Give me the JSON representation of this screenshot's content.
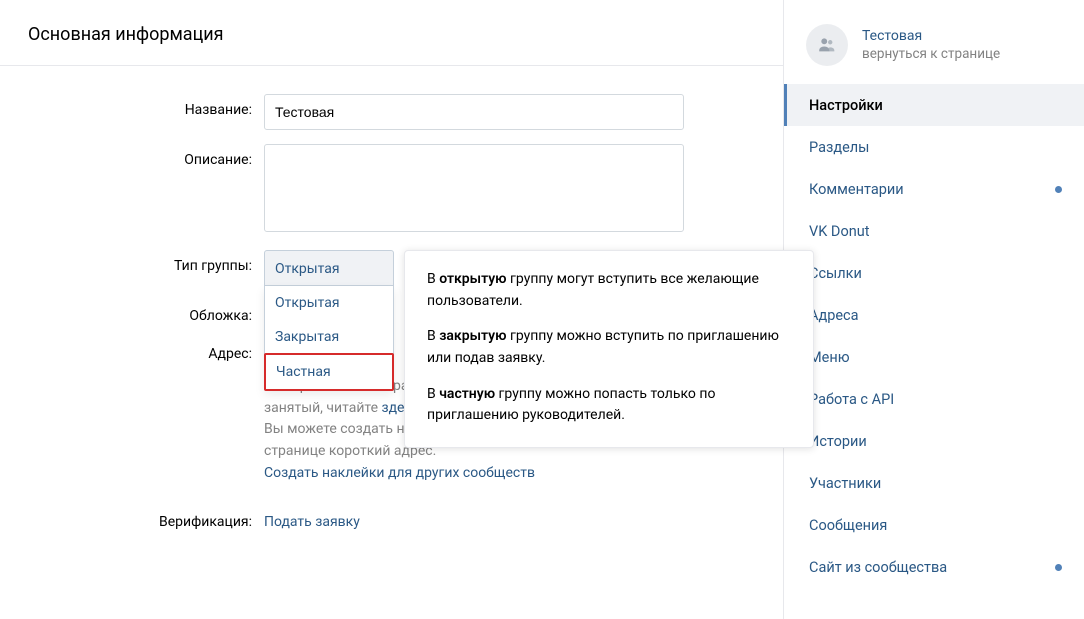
{
  "page_title": "Основная информация",
  "form": {
    "name_label": "Название:",
    "name_value": "Тестовая",
    "description_label": "Описание:",
    "description_value": "",
    "group_type_label": "Тип группы:",
    "group_type_selected": "Открытая",
    "group_type_options": [
      "Открытая",
      "Закрытая",
      "Частная"
    ],
    "cover_label": "Обложка:",
    "address_label": "Адрес:",
    "address_hint_1": "Как правильно выбрать адрес и можно ли использовать уже занятый, читайте ",
    "address_hint_link": "здесь",
    "address_hint_1_end": ".",
    "address_hint_2": "Вы можете создать наклейки для вашего сообщества, добавив странице короткий адрес.",
    "address_stickers_link": "Создать наклейки для других сообществ",
    "verification_label": "Верификация:",
    "verification_link": "Подать заявку"
  },
  "tooltip": {
    "open_pre": "В ",
    "open_bold": "открытую",
    "open_post": " группу могут вступить все желающие пользователи.",
    "closed_pre": "В ",
    "closed_bold": "закрытую",
    "closed_post": " группу можно вступить по приглашению или подав заявку.",
    "private_pre": "В ",
    "private_bold": "частную",
    "private_post": " группу можно попасть только по приглашению руководителей."
  },
  "sidebar": {
    "group_name": "Тестовая",
    "group_back": "вернуться к странице",
    "nav": [
      {
        "label": "Настройки",
        "selected": true,
        "dot": false
      },
      {
        "label": "Разделы",
        "selected": false,
        "dot": false
      },
      {
        "label": "Комментарии",
        "selected": false,
        "dot": true
      },
      {
        "label": "VK Donut",
        "selected": false,
        "dot": false
      },
      {
        "label": "Ссылки",
        "selected": false,
        "dot": false
      },
      {
        "label": "Адреса",
        "selected": false,
        "dot": false
      },
      {
        "label": "Меню",
        "selected": false,
        "dot": false
      },
      {
        "label": "Работа с API",
        "selected": false,
        "dot": false
      },
      {
        "label": "Истории",
        "selected": false,
        "dot": false
      },
      {
        "label": "Участники",
        "selected": false,
        "dot": false
      },
      {
        "label": "Сообщения",
        "selected": false,
        "dot": false
      },
      {
        "label": "Сайт из сообщества",
        "selected": false,
        "dot": true
      }
    ]
  }
}
